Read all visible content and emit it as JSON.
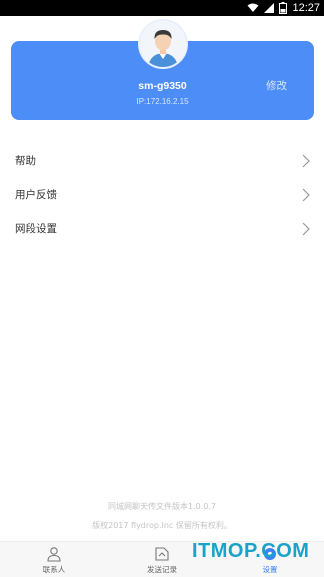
{
  "status_bar": {
    "time": "12:27",
    "battery": "2"
  },
  "profile": {
    "name": "sm-g9350",
    "ip": "IP:172.16.2.15",
    "edit_label": "修改"
  },
  "menu": [
    {
      "label": "帮助"
    },
    {
      "label": "用户反馈"
    },
    {
      "label": "网段设置"
    }
  ],
  "footer": {
    "version": "同城网聊天传文件版本1.0.0.7",
    "copyright": "版权2017 flydrop.Inc 保留所有权利。"
  },
  "nav": {
    "tabs": [
      {
        "label": "联系人",
        "icon": "person-icon"
      },
      {
        "label": "发送记录",
        "icon": "file-icon"
      },
      {
        "label": "设置",
        "icon": "settings-icon"
      }
    ],
    "active_index": 2
  },
  "watermark": "ITMOP.COM",
  "colors": {
    "accent": "#4d8df7",
    "status_bar": "#000000",
    "active_tab": "#3b82f6"
  }
}
